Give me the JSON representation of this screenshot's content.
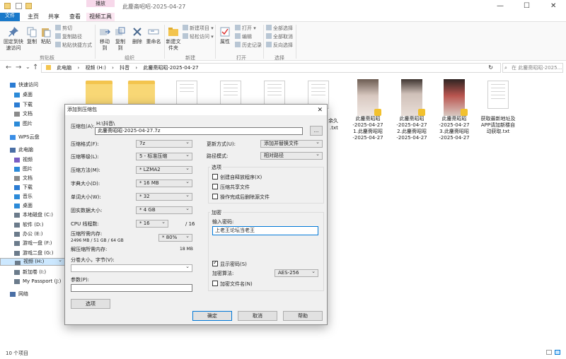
{
  "window": {
    "title": "此鏖斋昭昭-2025-04-27",
    "context_tab": "播放",
    "controls": {
      "minimize": "—",
      "maximize": "☐",
      "close": "✕"
    }
  },
  "ribbon": {
    "tabs": [
      {
        "label": "文件"
      },
      {
        "label": "主页"
      },
      {
        "label": "共享"
      },
      {
        "label": "查看"
      },
      {
        "label": "视频工具"
      }
    ],
    "clipboard": {
      "pin": "固定到快速访问",
      "copy": "复制",
      "paste": "粘贴",
      "cut": "剪切",
      "copy_path": "复制路径",
      "paste_shortcut": "粘贴快捷方式",
      "group": "剪贴板"
    },
    "organize": {
      "move_to": "移动到",
      "copy_to": "复制到",
      "delete": "删除",
      "rename": "重命名",
      "group": "组织"
    },
    "new": {
      "new_folder": "新建文件夹",
      "new_item": "新建项目 ▾",
      "easy_access": "轻松访问 ▾",
      "group": "新建"
    },
    "open": {
      "properties": "属性",
      "open": "打开 ▾",
      "edit": "编辑",
      "history": "历史记录",
      "group": "打开"
    },
    "select": {
      "select_all": "全部选择",
      "select_none": "全部取消",
      "invert": "反向选择",
      "group": "选择"
    }
  },
  "address": {
    "back": "←",
    "forward": "→",
    "dropdown": "⌄",
    "up": "↑",
    "crumbs": [
      "此电脑",
      "›",
      "视频 (H:)",
      "›",
      "抖音",
      "›",
      "此鏖斋昭昭-2025-04-27"
    ],
    "refresh": "↻",
    "search_placeholder": "在 此鏖斋昭昭-2025..."
  },
  "nav": {
    "items": [
      {
        "label": "快速访问",
        "color": "#2b7cd3"
      },
      {
        "label": "桌面",
        "color": "#2b8ad8"
      },
      {
        "label": "下载",
        "color": "#2b7cd3"
      },
      {
        "label": "文档",
        "color": "#8a8a8a"
      },
      {
        "label": "图片",
        "color": "#2b8ad8"
      },
      {
        "label": "WPS云盘",
        "color": "#3a8ee6"
      },
      {
        "label": "此电脑",
        "color": "#4a6fa5"
      },
      {
        "label": "视频",
        "color": "#7a5ec4"
      },
      {
        "label": "图片",
        "color": "#2b8ad8"
      },
      {
        "label": "文档",
        "color": "#8a8a8a"
      },
      {
        "label": "下载",
        "color": "#2b7cd3"
      },
      {
        "label": "音乐",
        "color": "#2b8ad8"
      },
      {
        "label": "桌面",
        "color": "#2b8ad8"
      },
      {
        "label": "本地磁盘 (C:)",
        "color": "#6b7b8b"
      },
      {
        "label": "软件 (D:)",
        "color": "#6b7b8b"
      },
      {
        "label": "办公 (E:)",
        "color": "#6b7b8b"
      },
      {
        "label": "游戏一盘 (F:)",
        "color": "#6b7b8b"
      },
      {
        "label": "游戏二盘 (G:)",
        "color": "#6b7b8b"
      },
      {
        "label": "视频 (H:)",
        "color": "#6b7b8b"
      },
      {
        "label": "新加卷 (I:)",
        "color": "#6b7b8b"
      },
      {
        "label": "My Passport (J:)",
        "color": "#6b7b8b"
      },
      {
        "label": "网络",
        "color": "#4a6fa5"
      }
    ]
  },
  "files": {
    "partial_name_1": "余久",
    "partial_name_2": ".txt",
    "videos": [
      {
        "line1": "此鏖斋昭昭",
        "line2": "-2025-04-27",
        "line3": "1.此鏖斋昭昭",
        "line4": "-2025-04-27"
      },
      {
        "line1": "此鏖斋昭昭",
        "line2": "-2025-04-27",
        "line3": "2.此鏖斋昭昭",
        "line4": "-2025-04-27"
      },
      {
        "line1": "此鏖斋昭昭",
        "line2": "-2025-04-27",
        "line3": "3.此鏖斋昭昭",
        "line4": "-2025-04-27"
      }
    ],
    "txt": {
      "line1": "获取最新地址及",
      "line2": "APP请加新楼自",
      "line3": "动获取.txt"
    }
  },
  "status": {
    "count": "10 个项目"
  },
  "dialog": {
    "title": "添加到压缩包",
    "close": "✕",
    "archive_label": "压缩包(A):",
    "archive_dir": "H:\\抖音\\",
    "archive_name": "此鏖斋昭昭-2025-04-27.7z",
    "browse": "...",
    "format_label": "压缩格式(F):",
    "format_value": "7z",
    "level_label": "压缩等级(L):",
    "level_value": "5 - 标准压缩",
    "method_label": "压缩方法(M):",
    "method_value": "* LZMA2",
    "dict_label": "字典大小(D):",
    "dict_value": "* 16 MB",
    "word_label": "单词大小(W):",
    "word_value": "* 32",
    "solid_label": "固实数据大小:",
    "solid_value": "* 4 GB",
    "cpu_label": "CPU 线程数:",
    "cpu_value": "* 16",
    "cpu_total": "/ 16",
    "mem_label": "压缩所需内存:",
    "mem_detail": "2496 MB / 51 GB / 64 GB",
    "mem_value": "* 80%",
    "demem_label": "解压缩所需内存:",
    "demem_value": "18 MB",
    "split_label": "分卷大小，字节(V):",
    "params_label": "参数(P):",
    "options_button": "选项",
    "update_label": "更新方式(U):",
    "update_value": "添加并替换文件",
    "path_label": "路径模式:",
    "path_value": "相对路径",
    "options_group": "选项",
    "opt_sfx": "创建自释放程序(X)",
    "opt_shared": "压缩共享文件",
    "opt_delete": "操作完成后删除源文件",
    "enc_group": "加密",
    "password_label": "输入密码:",
    "password_value": "上老王论坛当老王",
    "show_password": "显示密码(S)",
    "enc_method_label": "加密算法:",
    "enc_method_value": "AES-256",
    "enc_names": "加密文件名(N)",
    "ok": "确定",
    "cancel": "取消",
    "help": "帮助"
  }
}
